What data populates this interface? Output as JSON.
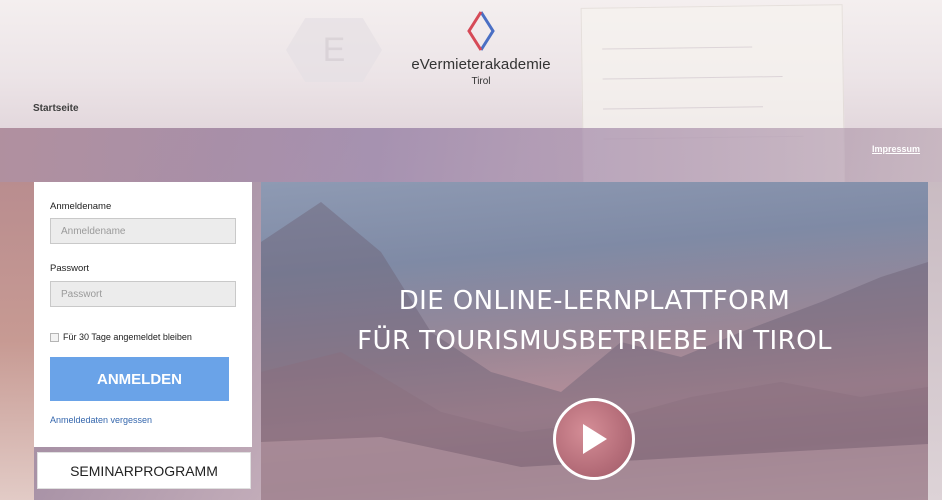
{
  "brand": {
    "name": "eVermieterakademie",
    "subtitle": "Tirol"
  },
  "nav": {
    "startseite": "Startseite",
    "impressum": "Impressum"
  },
  "login": {
    "username_label": "Anmeldename",
    "username_placeholder": "Anmeldename",
    "password_label": "Passwort",
    "password_placeholder": "Passwort",
    "remember_label": "Für 30 Tage angemeldet bleiben",
    "remember_checked": false,
    "submit_label": "ANMELDEN",
    "forgot_label": "Anmeldedaten vergessen"
  },
  "seminar": {
    "label": "SEMINARPROGRAMM"
  },
  "hero": {
    "line1": "DIE ONLINE-LERNPLATTFORM",
    "line2": "FÜR TOURISMUSBETRIEBE IN TIROL",
    "play_icon": "play-icon"
  },
  "colors": {
    "accent_button": "#6aa3e8",
    "link": "#3567ad",
    "logo_red": "#d64a57",
    "logo_blue": "#4a6fc4"
  }
}
